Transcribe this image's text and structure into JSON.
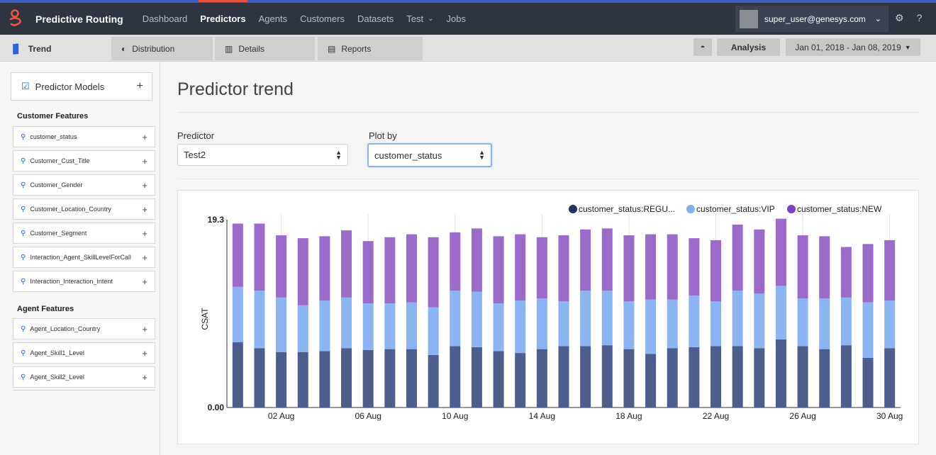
{
  "nav": {
    "brand": "Predictive Routing",
    "items": [
      "Dashboard",
      "Predictors",
      "Agents",
      "Customers",
      "Datasets",
      "Test",
      "Jobs"
    ],
    "active": "Predictors",
    "user": "super_user@genesys.com"
  },
  "subnav": {
    "tabs": [
      "Trend",
      "Distribution",
      "Details",
      "Reports"
    ],
    "active": "Trend",
    "analysis": "Analysis",
    "date_range": "Jan 01, 2018 - Jan 08, 2019"
  },
  "sidebar": {
    "models_label": "Predictor Models",
    "customer_features_heading": "Customer Features",
    "customer_features": [
      "customer_status",
      "Customer_Cust_Title",
      "Customer_Gender",
      "Customer_Location_Country",
      "Customer_Segment",
      "Interaction_Agent_SkillLevelForCall",
      "Interaction_Interaction_Intent"
    ],
    "agent_features_heading": "Agent Features",
    "agent_features": [
      "Agent_Location_Country",
      "Agent_Skill1_Level",
      "Agent_Skill2_Level"
    ]
  },
  "main": {
    "title": "Predictor trend",
    "predictor_label": "Predictor",
    "predictor_value": "Test2",
    "plotby_label": "Plot by",
    "plotby_value": "customer_status"
  },
  "colors": {
    "regular": "#4e5d8c",
    "vip": "#8db4f2",
    "new": "#9b6bcc",
    "legend_regular": "#1f3466",
    "legend_vip": "#7fb0f0",
    "legend_new": "#7b3fc4",
    "accent": "#e8533f"
  },
  "chart_data": {
    "type": "bar",
    "stacked": true,
    "ylabel": "CSAT",
    "ylim": [
      0,
      19.3
    ],
    "y_tick_labels": [
      "0.00",
      "19.3"
    ],
    "x_tick_labels": [
      "02 Aug",
      "06 Aug",
      "10 Aug",
      "14 Aug",
      "18 Aug",
      "22 Aug",
      "26 Aug",
      "30 Aug"
    ],
    "legend": [
      "customer_status:REGU...",
      "customer_status:VIP",
      "customer_status:NEW"
    ],
    "legend_position": "top-right",
    "categories": [
      "31 Jul",
      "01 Aug",
      "02 Aug",
      "03 Aug",
      "04 Aug",
      "05 Aug",
      "06 Aug",
      "07 Aug",
      "08 Aug",
      "09 Aug",
      "10 Aug",
      "11 Aug",
      "12 Aug",
      "13 Aug",
      "14 Aug",
      "15 Aug",
      "16 Aug",
      "17 Aug",
      "18 Aug",
      "19 Aug",
      "20 Aug",
      "21 Aug",
      "22 Aug",
      "23 Aug",
      "24 Aug",
      "25 Aug",
      "26 Aug",
      "27 Aug",
      "28 Aug",
      "29 Aug",
      "30 Aug"
    ],
    "series": [
      {
        "name": "customer_status:REGU...",
        "values": [
          6.7,
          6.1,
          5.7,
          5.7,
          5.8,
          6.1,
          5.9,
          6.0,
          6.0,
          5.4,
          6.3,
          6.2,
          5.8,
          5.6,
          6.0,
          6.3,
          6.3,
          6.4,
          6.0,
          5.5,
          6.1,
          6.2,
          6.3,
          6.3,
          6.1,
          7.0,
          6.3,
          6.0,
          6.4,
          5.1,
          6.1
        ]
      },
      {
        "name": "customer_status:VIP",
        "values": [
          5.7,
          5.9,
          5.6,
          4.8,
          5.2,
          5.2,
          4.8,
          4.7,
          4.8,
          4.9,
          5.7,
          5.7,
          4.9,
          5.4,
          5.2,
          4.6,
          5.7,
          5.6,
          4.9,
          5.6,
          5.0,
          5.3,
          4.6,
          5.7,
          5.6,
          5.5,
          4.9,
          5.2,
          4.9,
          5.7,
          4.9
        ]
      },
      {
        "name": "customer_status:NEW",
        "values": [
          6.5,
          6.9,
          6.4,
          6.9,
          6.6,
          6.9,
          6.4,
          6.8,
          7.0,
          7.2,
          6.0,
          6.5,
          6.9,
          6.8,
          6.3,
          6.8,
          6.3,
          6.4,
          6.8,
          6.7,
          6.7,
          5.9,
          6.3,
          6.8,
          6.6,
          6.9,
          6.5,
          6.4,
          5.2,
          6.0,
          6.2
        ]
      }
    ]
  }
}
